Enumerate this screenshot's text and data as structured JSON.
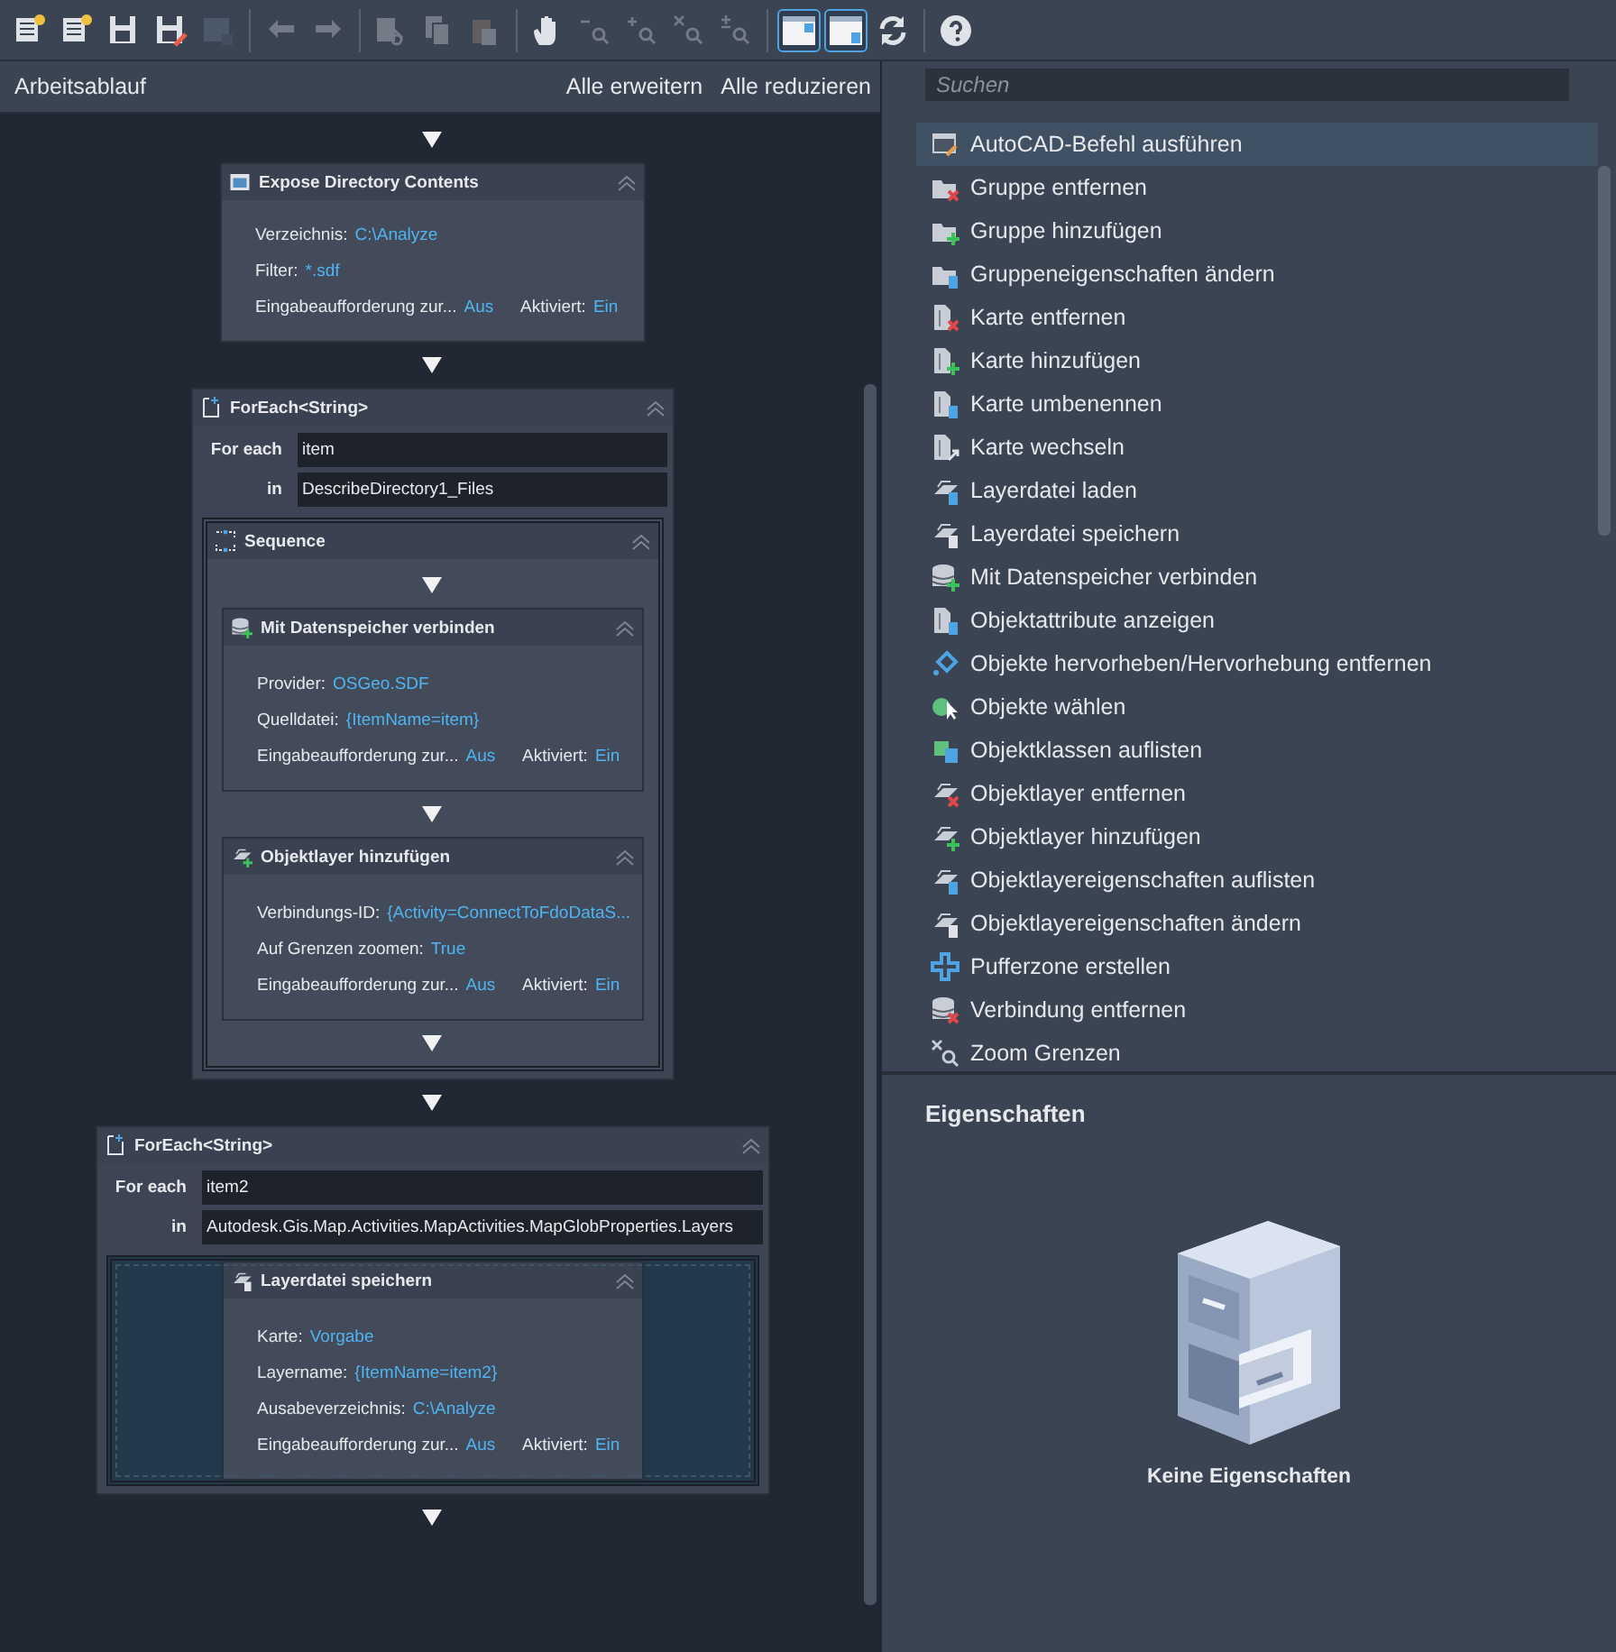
{
  "toolbar": {
    "buttons": [
      {
        "kind": "button",
        "disabled": false,
        "selected": false
      },
      {
        "kind": "button",
        "disabled": false,
        "selected": false
      },
      {
        "kind": "button",
        "disabled": false,
        "selected": false
      },
      {
        "kind": "button",
        "disabled": false,
        "selected": false
      },
      {
        "kind": "button",
        "disabled": true,
        "selected": false
      },
      {
        "kind": "separator"
      },
      {
        "kind": "button",
        "disabled": true,
        "selected": false
      },
      {
        "kind": "button",
        "disabled": true,
        "selected": false
      },
      {
        "kind": "separator"
      },
      {
        "kind": "button",
        "disabled": true,
        "selected": false
      },
      {
        "kind": "button",
        "disabled": true,
        "selected": false
      },
      {
        "kind": "button",
        "disabled": true,
        "selected": false
      },
      {
        "kind": "separator"
      },
      {
        "kind": "button",
        "disabled": false,
        "selected": false
      },
      {
        "kind": "button",
        "disabled": true,
        "selected": false
      },
      {
        "kind": "button",
        "disabled": true,
        "selected": false
      },
      {
        "kind": "button",
        "disabled": true,
        "selected": false
      },
      {
        "kind": "button",
        "disabled": true,
        "selected": false
      },
      {
        "kind": "separator"
      },
      {
        "kind": "button",
        "disabled": false,
        "selected": true
      },
      {
        "kind": "button",
        "disabled": false,
        "selected": true
      },
      {
        "kind": "button",
        "disabled": false,
        "selected": false
      },
      {
        "kind": "separator"
      },
      {
        "kind": "button",
        "disabled": false,
        "selected": false
      }
    ]
  },
  "workflow": {
    "title": "Arbeitsablauf",
    "actions": [
      "Alle erweitern",
      "Alle reduzieren"
    ],
    "activities": [
      {
        "kind": "activity",
        "title": "Expose Directory Contents",
        "rows": [
          [
            {
              "label": "Verzeichnis:",
              "value": "C:\\Analyze"
            }
          ],
          [
            {
              "label": "Filter:",
              "value": "*.sdf"
            }
          ],
          [
            {
              "label": "Eingabeaufforderung zur...",
              "value": "Aus"
            },
            {
              "label": "Aktiviert:",
              "value": "Ein"
            }
          ]
        ]
      },
      {
        "kind": "foreach",
        "title": "ForEach<String>",
        "for_each_label": "For each",
        "for_each": "item",
        "in_label": "in",
        "in": "DescribeDirectory1_Files",
        "body": {
          "kind": "sequence",
          "title": "Sequence",
          "children": [
            {
              "kind": "activity",
              "title": "Mit Datenspeicher verbinden",
              "rows": [
                [
                  {
                    "label": "Provider:",
                    "value": "OSGeo.SDF"
                  }
                ],
                [
                  {
                    "label": "Quelldatei:",
                    "value": "{ItemName=item}"
                  }
                ],
                [
                  {
                    "label": "Eingabeaufforderung zur...",
                    "value": "Aus"
                  },
                  {
                    "label": "Aktiviert:",
                    "value": "Ein"
                  }
                ]
              ]
            },
            {
              "kind": "activity",
              "title": "Objektlayer hinzufügen",
              "rows": [
                [
                  {
                    "label": "Verbindungs-ID:",
                    "value": "{Activity=ConnectToFdoDataS..."
                  }
                ],
                [
                  {
                    "label": "Auf Grenzen zoomen:",
                    "value": "True"
                  }
                ],
                [
                  {
                    "label": "Eingabeaufforderung zur...",
                    "value": "Aus"
                  },
                  {
                    "label": "Aktiviert:",
                    "value": "Ein"
                  }
                ]
              ]
            }
          ]
        }
      },
      {
        "kind": "foreach",
        "title": "ForEach<String>",
        "for_each_label": "For each",
        "for_each": "item2",
        "in_label": "in",
        "in": "Autodesk.Gis.Map.Activities.MapActivities.MapGlobProperties.Layers",
        "body": {
          "kind": "activity",
          "title": "Layerdatei speichern",
          "rows": [
            [
              {
                "label": "Karte:",
                "value": "Vorgabe"
              }
            ],
            [
              {
                "label": "Layername:",
                "value": "{ItemName=item2}"
              }
            ],
            [
              {
                "label": "Ausabeverzeichnis:",
                "value": "C:\\Analyze"
              }
            ],
            [
              {
                "label": "Eingabeaufforderung zur...",
                "value": "Aus"
              },
              {
                "label": "Aktiviert:",
                "value": "Ein"
              }
            ]
          ]
        }
      }
    ]
  },
  "activity_list": {
    "search": {
      "placeholder": "Suchen"
    },
    "items": [
      {
        "label": "AutoCAD-Befehl ausführen",
        "selected": true
      },
      {
        "label": "Gruppe entfernen",
        "selected": false
      },
      {
        "label": "Gruppe hinzufügen",
        "selected": false
      },
      {
        "label": "Gruppeneigenschaften ändern",
        "selected": false
      },
      {
        "label": "Karte entfernen",
        "selected": false
      },
      {
        "label": "Karte hinzufügen",
        "selected": false
      },
      {
        "label": "Karte umbenennen",
        "selected": false
      },
      {
        "label": "Karte wechseln",
        "selected": false
      },
      {
        "label": "Layerdatei laden",
        "selected": false
      },
      {
        "label": "Layerdatei speichern",
        "selected": false
      },
      {
        "label": "Mit Datenspeicher verbinden",
        "selected": false
      },
      {
        "label": "Objektattribute anzeigen",
        "selected": false
      },
      {
        "label": "Objekte hervorheben/Hervorhebung entfernen",
        "selected": false
      },
      {
        "label": "Objekte wählen",
        "selected": false
      },
      {
        "label": "Objektklassen auflisten",
        "selected": false
      },
      {
        "label": "Objektlayer entfernen",
        "selected": false
      },
      {
        "label": "Objektlayer hinzufügen",
        "selected": false
      },
      {
        "label": "Objektlayereigenschaften auflisten",
        "selected": false
      },
      {
        "label": "Objektlayereigenschaften ändern",
        "selected": false
      },
      {
        "label": "Pufferzone erstellen",
        "selected": false
      },
      {
        "label": "Verbindung entfernen",
        "selected": false
      },
      {
        "label": "Zoom Grenzen",
        "selected": false
      }
    ]
  },
  "properties": {
    "title": "Eigenschaften",
    "empty_text": "Keine Eigenschaften"
  }
}
